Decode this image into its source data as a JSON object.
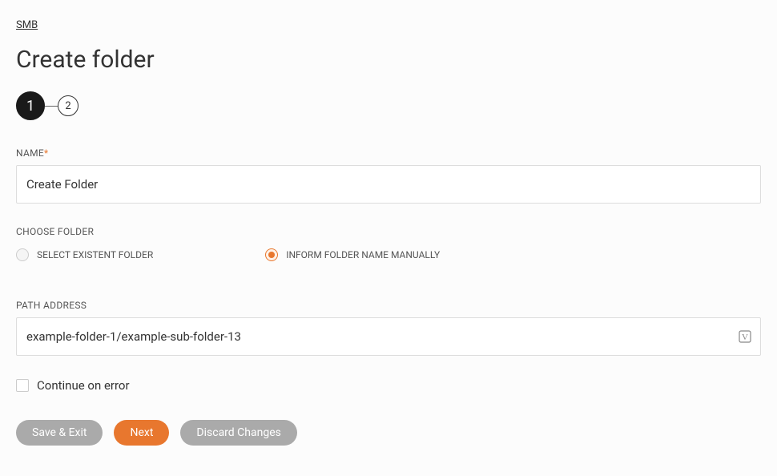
{
  "breadcrumb": "SMB",
  "pageTitle": "Create folder",
  "stepper": {
    "step1": "1",
    "step2": "2"
  },
  "fields": {
    "name": {
      "label": "NAME",
      "value": "Create Folder"
    },
    "chooseFolder": {
      "label": "CHOOSE FOLDER",
      "options": {
        "selectExistent": "SELECT EXISTENT FOLDER",
        "informManually": "INFORM FOLDER NAME MANUALLY"
      }
    },
    "pathAddress": {
      "label": "PATH ADDRESS",
      "value": "example-folder-1/example-sub-folder-13"
    },
    "continueOnError": {
      "label": "Continue on error"
    }
  },
  "buttons": {
    "saveExit": "Save & Exit",
    "next": "Next",
    "discard": "Discard Changes"
  }
}
